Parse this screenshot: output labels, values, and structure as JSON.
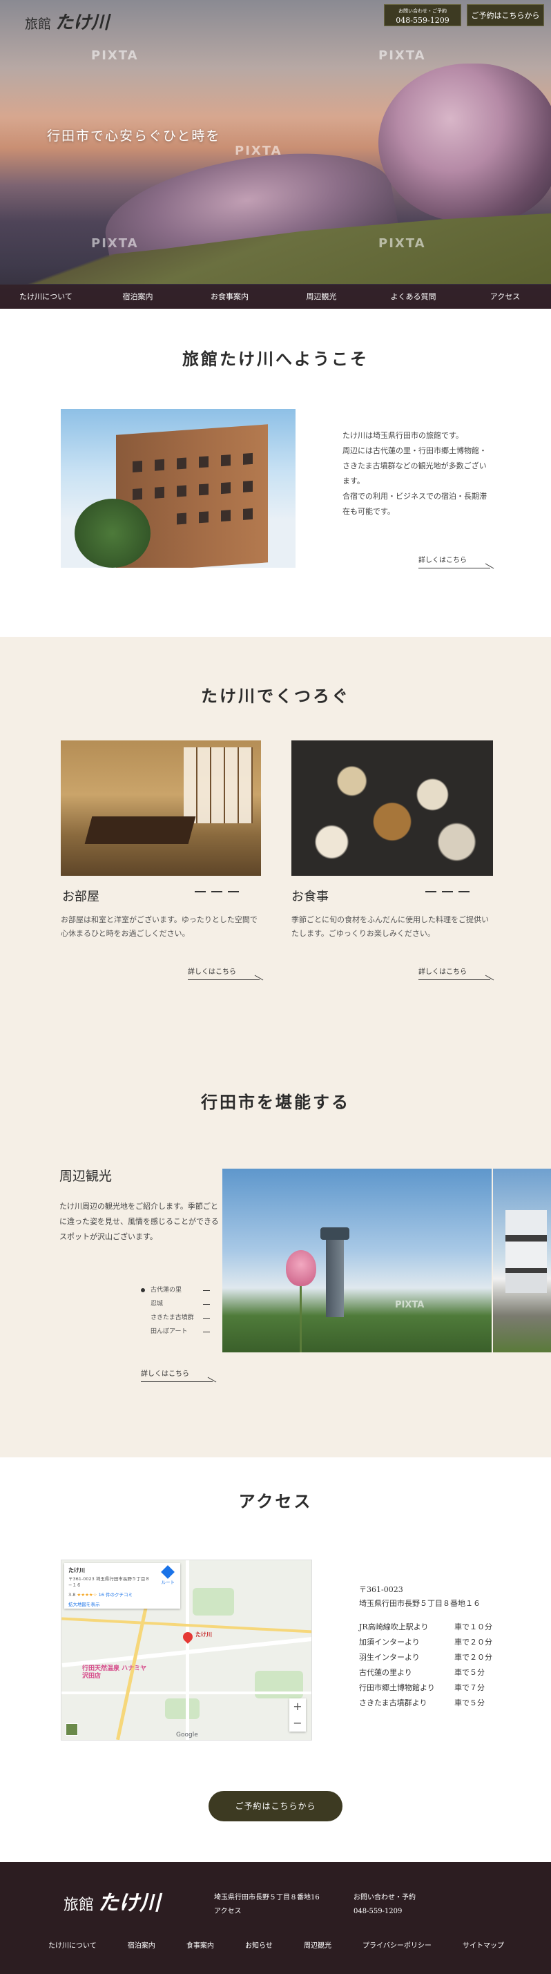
{
  "header": {
    "logo_prefix": "旅館",
    "logo_name": "たけ川",
    "tel_small": "お問い合わせ・ご予約",
    "tel": "048-559-1209",
    "reserve_button": "ご予約はこちらから",
    "catch_copy": "行田市で心安らぐひと時を",
    "watermark": "PIXTA",
    "nav": [
      "たけ川について",
      "宿泊案内",
      "お食事案内",
      "周辺観光",
      "よくある質問",
      "アクセス"
    ]
  },
  "welcome": {
    "title": "旅館たけ川へようこそ",
    "lines": [
      "たけ川は埼玉県行田市の旅館です。",
      "周辺には古代蓮の里・行田市郷土博物館・",
      "さきたま古墳群などの観光地が多数ござい",
      "ます。",
      "合宿での利用・ビジネスでの宿泊・長期滞",
      "在も可能です。"
    ],
    "more": "詳しくはこちら"
  },
  "relax": {
    "title": "たけ川でくつろぐ",
    "cards": [
      {
        "title": "お部屋",
        "text": "お部屋は和室と洋室がございます。ゆったりとした空間で心休まるひと時をお過ごしください。",
        "more": "詳しくはこちら"
      },
      {
        "title": "お食事",
        "text": "季節ごとに旬の食材をふんだんに使用した料理をご提供いたします。ごゆっくりお楽しみください。",
        "more": "詳しくはこちら"
      }
    ]
  },
  "sightseeing": {
    "title": "行田市を堪能する",
    "heading": "周辺観光",
    "text": "たけ川周辺の観光地をご紹介します。季節ごとに違った姿を見せ、風情を感じることができるスポットが沢山ございます。",
    "slides": [
      "古代蓮の里",
      "忍城",
      "さきたま古墳群",
      "田んぼアート"
    ],
    "active_slide": 0,
    "more": "詳しくはこちら"
  },
  "access": {
    "title": "アクセス",
    "map": {
      "place": "たけ川",
      "address": "〒361-0023 埼玉県行田市長野５丁目８−１６",
      "rating": "3.8",
      "stars": "★★★★☆",
      "reviews": "16 件のクチコミ",
      "larger_map": "拡大地図を表示",
      "route": "ルート",
      "pin_label": "たけ川",
      "poi_1": "行田天然温泉 ハナミヤ沢田店",
      "zoom_in": "+",
      "zoom_out": "−",
      "google": "Google"
    },
    "postal": "〒361-0023",
    "address": "埼玉県行田市長野５丁目８番地１６",
    "routes": [
      {
        "from": "JR高崎線吹上駅より",
        "time": "車で１０分"
      },
      {
        "from": "加須インターより",
        "time": "車で２０分"
      },
      {
        "from": "羽生インターより",
        "time": "車で２０分"
      },
      {
        "from": "古代蓮の里より",
        "time": "車で５分"
      },
      {
        "from": "行田市郷土博物館より",
        "time": "車で７分"
      },
      {
        "from": "さきたま古墳群より",
        "time": "車で５分"
      }
    ],
    "reserve_button": "ご予約はこちらから"
  },
  "footer": {
    "logo_prefix": "旅館",
    "logo_name": "たけ川",
    "address": "埼玉県行田市長野５丁目８番地16",
    "access_link": "アクセス",
    "tel_label": "お問い合わせ・予約",
    "tel": "048-559-1209",
    "nav": [
      "たけ川について",
      "宿泊案内",
      "食事案内",
      "お知らせ",
      "周辺観光",
      "プライバシーポリシー",
      "サイトマップ"
    ]
  }
}
